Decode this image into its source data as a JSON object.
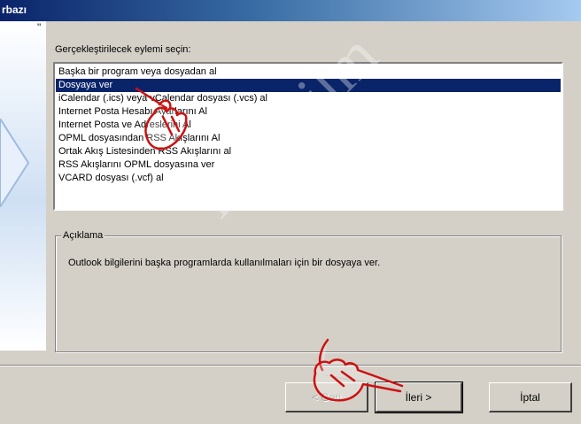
{
  "window": {
    "title": "rbazı"
  },
  "quote_mark": "\"",
  "prompt": "Gerçekleştirilecek eylemi seçin:",
  "actions": [
    "Başka bir program veya dosyadan al",
    "Dosyaya ver",
    "iCalendar (.ics) veya vCalendar dosyası (.vcs) al",
    "Internet Posta Hesabı Ayarlarını Al",
    "Internet Posta ve Adreslerini Al",
    "OPML dosyasından RSS Akışlarını Al",
    "Ortak Akış Listesinden RSS Akışlarını al",
    "RSS Akışlarını OPML dosyasına ver",
    "VCARD dosyası (.vcf) al"
  ],
  "selected_action": "Dosyaya ver",
  "description": {
    "legend": "Açıklama",
    "text": "Outlook bilgilerini başka programlarda kullanılmaları için bir dosyaya ver."
  },
  "buttons": {
    "back": "< Geri",
    "next": "İleri >",
    "cancel": "İptal"
  },
  "watermark": "interbilm",
  "colors": {
    "selection": "#0a246a",
    "title_start": "#0a246a",
    "title_end": "#a6caf0",
    "hand": "#cc1111"
  }
}
